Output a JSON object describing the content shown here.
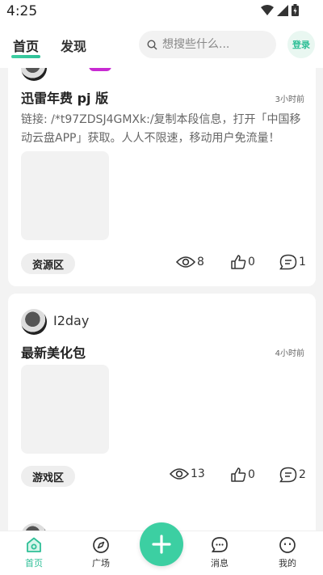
{
  "status": {
    "time": "4:25"
  },
  "header": {
    "tabs": [
      {
        "label": "首页"
      },
      {
        "label": "发现"
      }
    ],
    "search_placeholder": "想搜些什么...",
    "login_label": "登录"
  },
  "posts": [
    {
      "username": "",
      "title": "迅雷年费 pj 版",
      "time": "3小时前",
      "desc": "链接: /*t97ZDSJ4GMXk:/复制本段信息，打开「中国移动云盘APP」获取。人人不限速，移动用户免流量！",
      "tag": "资源区",
      "views": "8",
      "likes": "0",
      "comments": "1"
    },
    {
      "username": "I2day",
      "title": "最新美化包",
      "time": "4小时前",
      "desc": "",
      "tag": "游戏区",
      "views": "13",
      "likes": "0",
      "comments": "2"
    }
  ],
  "nav": {
    "items": [
      {
        "label": "首页"
      },
      {
        "label": "广场"
      },
      {
        "label": "消息"
      },
      {
        "label": "我的"
      }
    ]
  },
  "colors": {
    "accent": "#3ccfa2",
    "badge": "#c82ad2"
  }
}
